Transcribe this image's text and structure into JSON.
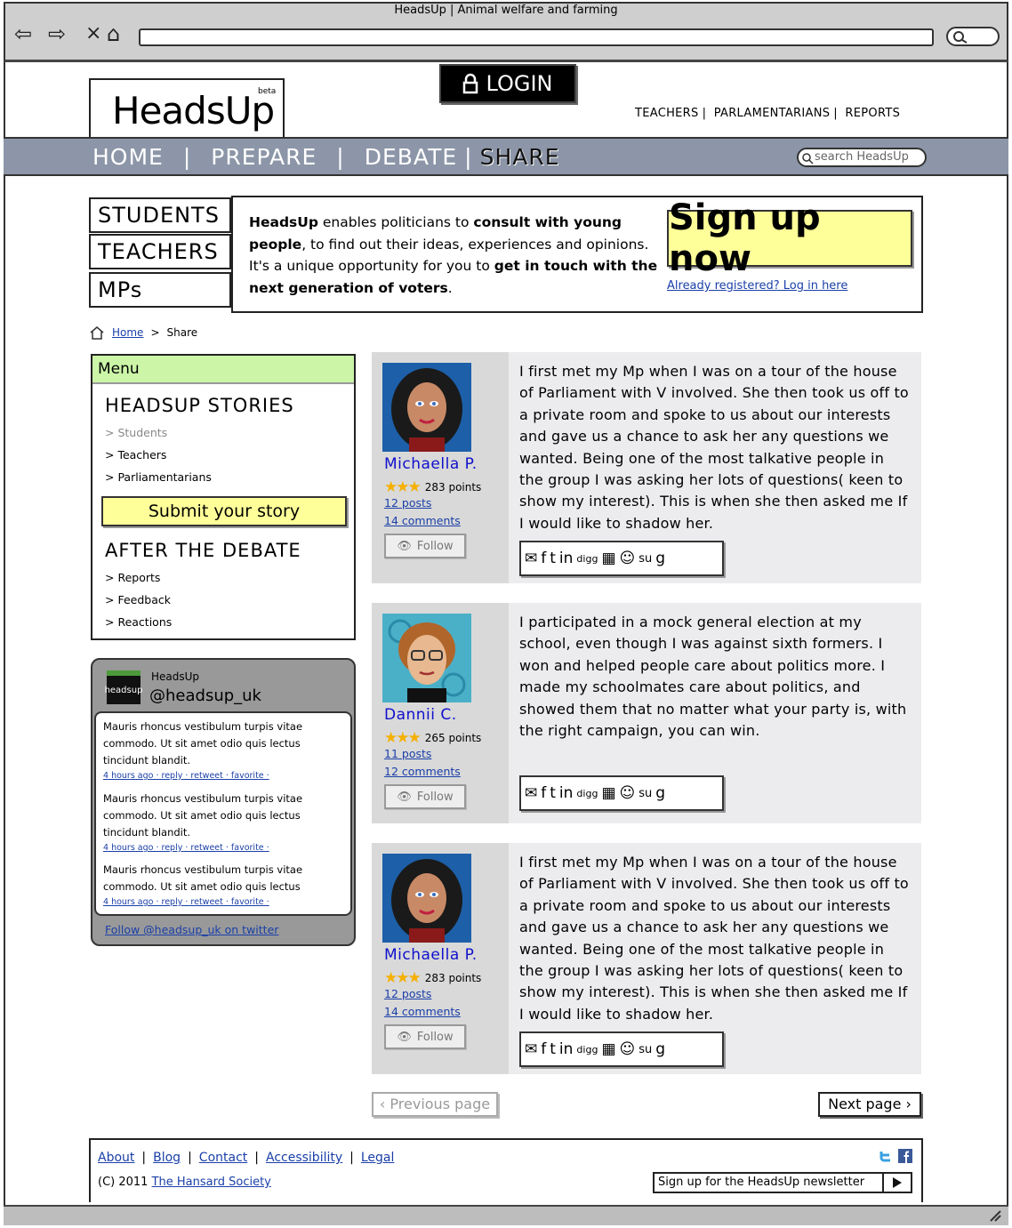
{
  "browser": {
    "title": "HeadsUp | Animal welfare and farming",
    "back_icon": "⇦",
    "forward_icon": "⇨",
    "close_icon": "×",
    "home_icon": "⌂"
  },
  "header": {
    "logo": "HeadsUp",
    "beta": "beta",
    "login": "LOGIN",
    "top_links": [
      "TEACHERS",
      "PARLAMENTARIANS",
      "REPORTS"
    ],
    "nav": [
      "HOME",
      "PREPARE",
      "DEBATE",
      "SHARE"
    ],
    "search_placeholder": "search HeadsUp"
  },
  "hero": {
    "tabs": [
      "STUDENTS",
      "TEACHERS",
      "MPs"
    ],
    "text_parts": {
      "b1": "HeadsUp",
      "t1": " enables politicians to ",
      "b2": "consult with young people",
      "t2": ", to find out their ideas, experiences and opinions.",
      "t3": "It's a unique opportunity for you to ",
      "b3": "get in touch with the next generation of voters",
      "t4": "."
    },
    "signup": "Sign up now",
    "registered": "Already registered? Log in here"
  },
  "breadcrumb": {
    "home": "Home",
    "sep": ">",
    "current": "Share"
  },
  "menu": {
    "title": "Menu",
    "stories_heading": "HEADSUP STORIES",
    "stories_items": [
      "> Students",
      "> Teachers",
      "> Parliamentarians"
    ],
    "submit": "Submit your story",
    "after_heading": "AFTER THE DEBATE",
    "after_items": [
      "> Reports",
      "> Feedback",
      "> Reactions"
    ]
  },
  "twitter": {
    "logo": "headsup",
    "name": "HeadsUp",
    "handle": "@headsup_uk",
    "tweets": [
      {
        "text": "Mauris rhoncus vestibulum turpis vitae commodo. Ut sit amet odio quis lectus tincidunt blandit.",
        "meta": "4 hours ago · reply · retweet · favorite ·"
      },
      {
        "text": "Mauris rhoncus vestibulum turpis vitae commodo. Ut sit amet odio quis lectus tincidunt blandit.",
        "meta": "4 hours ago · reply · retweet · favorite ·"
      },
      {
        "text": "Mauris rhoncus vestibulum turpis vitae commodo. Ut sit amet odio quis lectus",
        "meta": "4 hours ago · reply · retweet · favorite ·"
      }
    ],
    "follow": "Follow @headsup_uk on twitter"
  },
  "stories": [
    {
      "author": "Michaella P.",
      "stars": "★★★",
      "points": "283 points",
      "posts": "12 posts",
      "comments": "14 comments",
      "follow": "Follow",
      "text": "I first met my Mp when I was on a tour of the house of Parliament with V involved. She then took us off to a private room and spoke to us about our interests and gave us a chance to ask her any questions we wanted. Being one of the most talkative people in the group I was asking her lots of questions( keen to show my interest). This is when she then asked me If I would like to shadow her.",
      "avatar": "dark"
    },
    {
      "author": "Dannii C.",
      "stars": "★★★",
      "points": "265 points",
      "posts": "11 posts",
      "comments": "12 comments",
      "follow": "Follow",
      "text": "I participated in a mock general election at my school, even though I was against sixth formers. I won and helped people care about politics more. I made my schoolmates care about politics, and showed them that no matter what your party is, with the right campaign, you can win.",
      "avatar": "light"
    },
    {
      "author": "Michaella P.",
      "stars": "★★★",
      "points": "283 points",
      "posts": "12 posts",
      "comments": "14 comments",
      "follow": "Follow",
      "text": "I first met my Mp when I was on a tour of the house of Parliament with V involved. She then took us off to a private room and spoke to us about our interests and gave us a chance to ask her any questions we wanted. Being one of the most talkative people in the group I was asking her lots of questions( keen to show my interest). This is when she then asked me If I would like to shadow her.",
      "avatar": "dark"
    }
  ],
  "share_icons": [
    "email-icon",
    "facebook-icon",
    "twitter-icon",
    "linkedin-icon",
    "digg-icon",
    "delicious-icon",
    "reddit-icon",
    "stumbleupon-icon",
    "google-icon"
  ],
  "pagination": {
    "prev": "‹ Previous page",
    "next": "Next page ›"
  },
  "footer": {
    "links": [
      "About",
      "Blog",
      "Contact",
      "Accessibility",
      "Legal"
    ],
    "copyright": "(C) 2011 ",
    "society": "The Hansard Society",
    "newsletter": "Sign up for the HeadsUp newsletter"
  },
  "colors": {
    "nav_bg": "#8c96a8",
    "highlight": "#ffff99",
    "menu_head": "#ccf5a8",
    "link": "#1a3fa8",
    "author": "#1010cc",
    "star": "#f5b000"
  }
}
